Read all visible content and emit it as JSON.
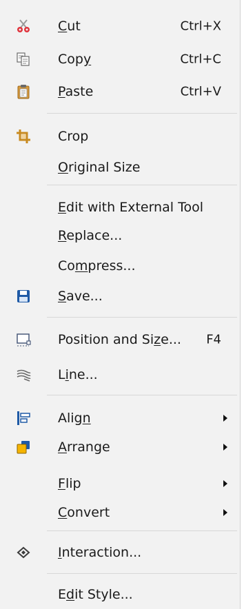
{
  "menu": {
    "items": [
      {
        "id": "cut",
        "pre": "",
        "u": "C",
        "post": "ut",
        "shortcut": "Ctrl+X",
        "icon": "scissors-icon"
      },
      {
        "id": "copy",
        "pre": "Cop",
        "u": "y",
        "post": "",
        "shortcut": "Ctrl+C",
        "icon": "copy-icon"
      },
      {
        "id": "paste",
        "pre": "",
        "u": "P",
        "post": "aste",
        "shortcut": "Ctrl+V",
        "icon": "clipboard-icon"
      },
      {
        "id": "crop",
        "pre": "Crop",
        "u": "",
        "post": "",
        "shortcut": "",
        "icon": "crop-icon"
      },
      {
        "id": "original-size",
        "pre": "",
        "u": "O",
        "post": "riginal Size",
        "shortcut": "",
        "icon": ""
      },
      {
        "id": "edit-external",
        "pre": "",
        "u": "E",
        "post": "dit with External Tool",
        "shortcut": "",
        "icon": ""
      },
      {
        "id": "replace",
        "pre": "",
        "u": "R",
        "post": "eplace...",
        "shortcut": "",
        "icon": ""
      },
      {
        "id": "compress",
        "pre": "Co",
        "u": "m",
        "post": "press...",
        "shortcut": "",
        "icon": ""
      },
      {
        "id": "save",
        "pre": "",
        "u": "S",
        "post": "ave...",
        "shortcut": "",
        "icon": "save-icon"
      },
      {
        "id": "position-size",
        "pre": "Position and Si",
        "u": "z",
        "post": "e...",
        "shortcut": "F4",
        "icon": "position-size-icon"
      },
      {
        "id": "line",
        "pre": "L",
        "u": "i",
        "post": "ne...",
        "shortcut": "",
        "icon": "line-icon"
      },
      {
        "id": "align",
        "pre": "Alig",
        "u": "n",
        "post": "",
        "shortcut": "",
        "icon": "align-icon",
        "submenu": true
      },
      {
        "id": "arrange",
        "pre": "",
        "u": "A",
        "post": "rrange",
        "shortcut": "",
        "icon": "arrange-icon",
        "submenu": true
      },
      {
        "id": "flip",
        "pre": "",
        "u": "F",
        "post": "lip",
        "shortcut": "",
        "icon": "",
        "submenu": true
      },
      {
        "id": "convert",
        "pre": "",
        "u": "C",
        "post": "onvert",
        "shortcut": "",
        "icon": "",
        "submenu": true
      },
      {
        "id": "interaction",
        "pre": "",
        "u": "I",
        "post": "nteraction...",
        "shortcut": "",
        "icon": "interaction-icon"
      },
      {
        "id": "edit-style",
        "pre": "E",
        "u": "d",
        "post": "it Style...",
        "shortcut": "",
        "icon": ""
      }
    ]
  }
}
